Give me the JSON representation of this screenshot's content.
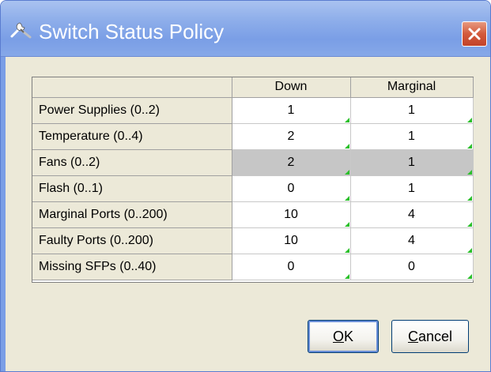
{
  "window": {
    "title": "Switch Status Policy",
    "icon": "wrench-screwdriver-icon",
    "close_icon": "close-icon"
  },
  "table": {
    "columns": [
      "",
      "Down",
      "Marginal"
    ],
    "rows": [
      {
        "label": "Power Supplies (0..2)",
        "down": "1",
        "marginal": "1"
      },
      {
        "label": "Temperature (0..4)",
        "down": "2",
        "marginal": "1"
      },
      {
        "label": "Fans (0..2)",
        "down": "2",
        "marginal": "1"
      },
      {
        "label": "Flash (0..1)",
        "down": "0",
        "marginal": "1"
      },
      {
        "label": "Marginal Ports (0..200)",
        "down": "10",
        "marginal": "4"
      },
      {
        "label": "Faulty Ports (0..200)",
        "down": "10",
        "marginal": "4"
      },
      {
        "label": "Missing SFPs (0..40)",
        "down": "0",
        "marginal": "0"
      }
    ],
    "selected_row": 2
  },
  "buttons": {
    "ok": {
      "mnemonic": "O",
      "rest": "K"
    },
    "cancel": {
      "mnemonic": "C",
      "rest": "ancel"
    }
  },
  "colors": {
    "titlebar": "#7a9ee6",
    "close_button": "#d35a3c",
    "edit_marker": "#2bbf2b",
    "selected_row": "#c6c6c6"
  }
}
